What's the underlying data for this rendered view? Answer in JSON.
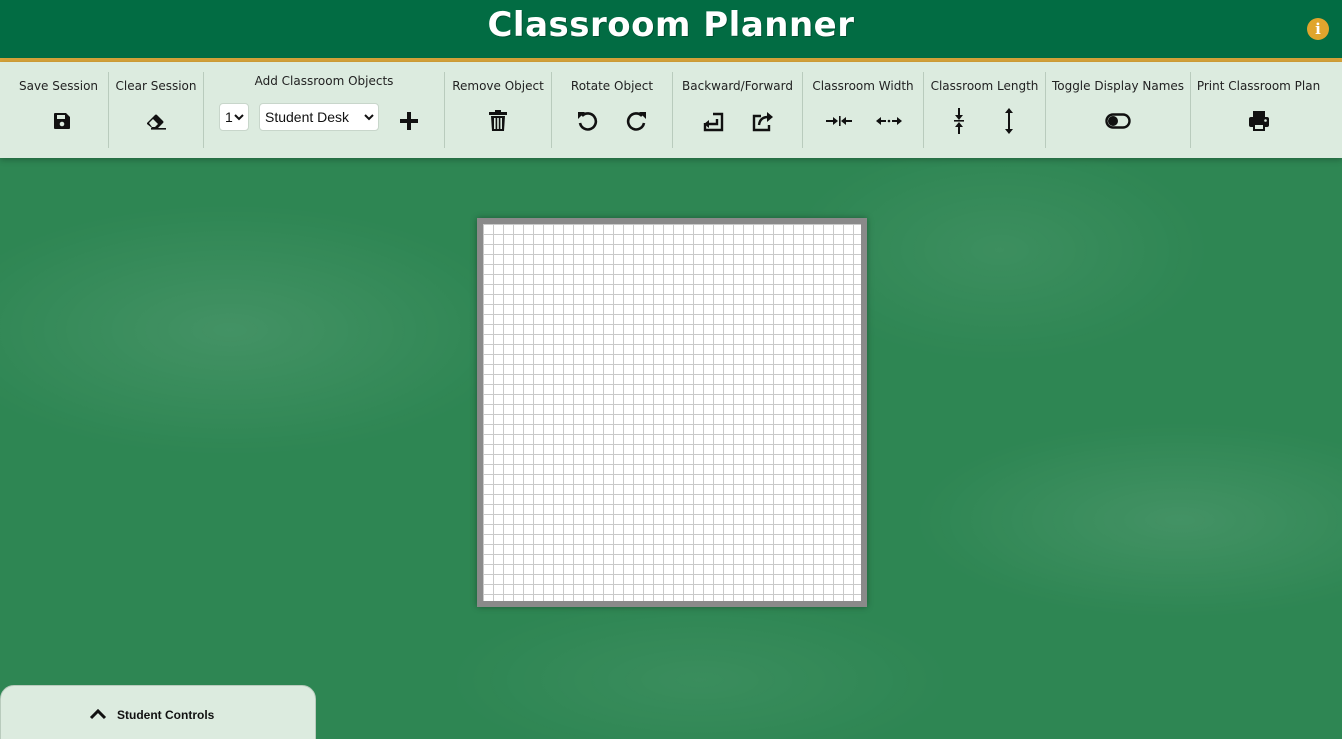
{
  "header": {
    "title": "Classroom Planner",
    "info_icon": "info-icon",
    "info_glyph": "i",
    "colors": {
      "header_bg": "#026c43",
      "accent_border": "#d7a33a",
      "info_button": "#e0a52d"
    }
  },
  "toolbar": {
    "save_session": {
      "label": "Save Session",
      "icon": "floppy-disk-icon"
    },
    "clear_session": {
      "label": "Clear Session",
      "icon": "eraser-icon"
    },
    "add_objects": {
      "label": "Add Classroom Objects",
      "quantity": "1",
      "object_type": "Student Desk",
      "add_icon": "plus-icon"
    },
    "remove_object": {
      "label": "Remove Object",
      "icon": "trash-icon"
    },
    "rotate_object": {
      "label": "Rotate Object",
      "icons": [
        "rotate-left-icon",
        "rotate-right-icon"
      ]
    },
    "backward_forward": {
      "label": "Backward/Forward",
      "icons": [
        "send-backward-icon",
        "bring-forward-icon"
      ]
    },
    "classroom_width": {
      "label": "Classroom Width",
      "icons": [
        "compress-width-icon",
        "expand-width-icon"
      ]
    },
    "classroom_length": {
      "label": "Classroom Length",
      "icons": [
        "compress-length-icon",
        "expand-length-icon"
      ]
    },
    "toggle_names": {
      "label": "Toggle Display Names",
      "icon": "toggle-icon"
    },
    "print_plan": {
      "label": "Print Classroom Plan",
      "icon": "printer-icon"
    }
  },
  "student_controls": {
    "label": "Student Controls",
    "icon": "chevron-up-icon"
  },
  "colors": {
    "chalkboard": "#2e8653",
    "toolbar_bg": "#dcebdf",
    "grid_line": "#c9c9c9"
  }
}
